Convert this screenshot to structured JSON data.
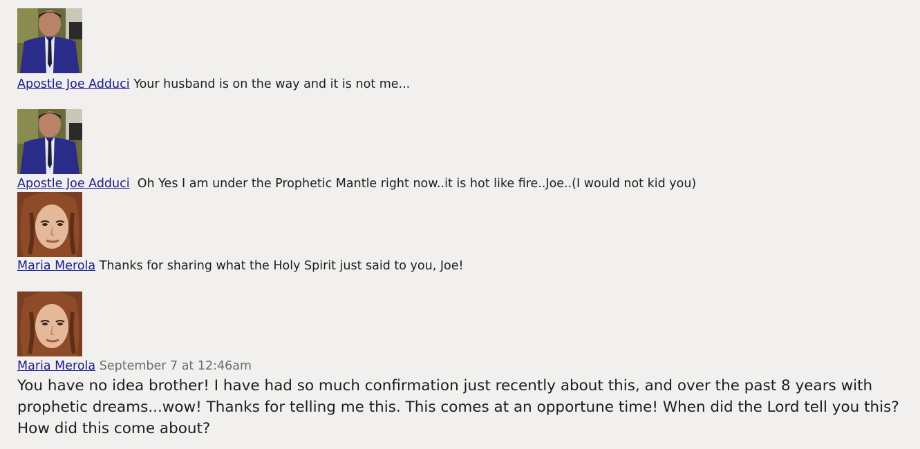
{
  "messages": [
    {
      "author": "Apostle Joe Adduci",
      "avatar_icon": "avatar-man-suit-icon",
      "text": "Your husband is on the way and it is not me..."
    },
    {
      "author": "Apostle Joe Adduci",
      "avatar_icon": "avatar-man-suit-icon",
      "text": "Oh Yes I am under the Prophetic Mantle right now..it is hot like fire..Joe..(I would not kid you)"
    },
    {
      "author": "Maria Merola",
      "avatar_icon": "avatar-woman-curly-hair-icon",
      "text": "Thanks for sharing what the Holy Spirit just said to you, Joe!"
    },
    {
      "author": "Maria Merola",
      "avatar_icon": "avatar-woman-curly-hair-icon",
      "timestamp": "September 7 at 12:46am",
      "text": "You have no idea brother! I have had so much confirmation just recently about this, and over the past 8 years with prophetic dreams...wow! Thanks for telling me this. This comes at an opportune time! When did the Lord tell you this? How did this come about?"
    }
  ],
  "colors": {
    "background": "#f1f0ee",
    "link": "#1a1a8f",
    "text": "#1d1d1d",
    "timestamp": "#6c6c6c"
  }
}
